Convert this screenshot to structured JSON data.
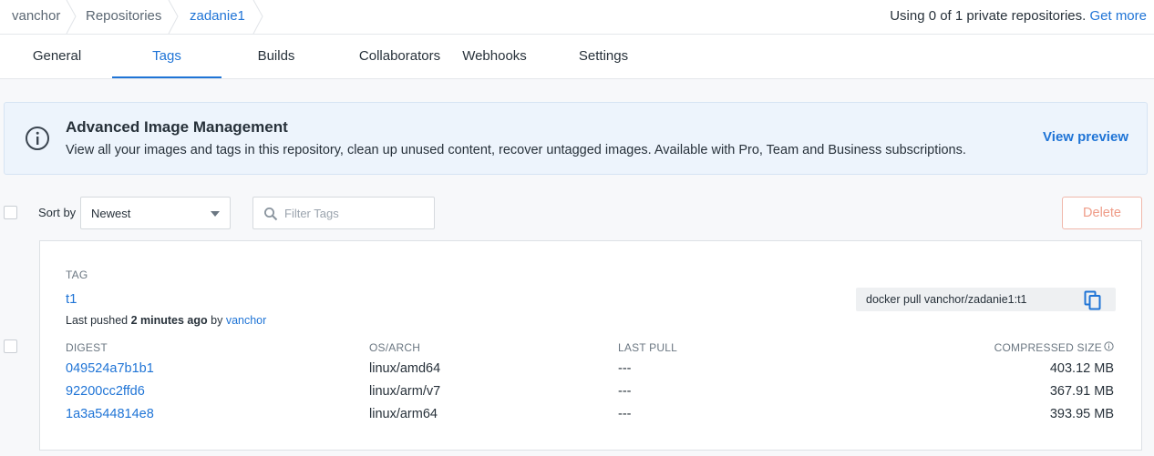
{
  "breadcrumb": {
    "items": [
      "vanchor",
      "Repositories",
      "zadanie1"
    ]
  },
  "usage": {
    "text": "Using 0 of 1 private repositories.",
    "link": "Get more"
  },
  "tabs": [
    "General",
    "Tags",
    "Builds",
    "Collaborators",
    "Webhooks",
    "Settings"
  ],
  "active_tab": "Tags",
  "banner": {
    "icon": "info-icon",
    "title": "Advanced Image Management",
    "text": "View all your images and tags in this repository, clean up unused content, recover untagged images. Available with Pro, Team and Business subscriptions.",
    "link": "View preview"
  },
  "filters": {
    "sort_label": "Sort by",
    "sort_value": "Newest",
    "filter_placeholder": "Filter Tags",
    "delete_label": "Delete"
  },
  "tag": {
    "header": "TAG",
    "name": "t1",
    "pushed_prefix": "Last pushed",
    "pushed_time": "2 minutes ago",
    "pushed_by_word": "by",
    "pushed_by": "vanchor",
    "pull_command": "docker pull vanchor/zadanie1:t1",
    "columns": [
      "DIGEST",
      "OS/ARCH",
      "LAST PULL",
      "COMPRESSED SIZE"
    ],
    "rows": [
      {
        "digest": "049524a7b1b1",
        "os_arch": "linux/amd64",
        "last_pull": "---",
        "size": "403.12 MB"
      },
      {
        "digest": "92200cc2ffd6",
        "os_arch": "linux/arm/v7",
        "last_pull": "---",
        "size": "367.91 MB"
      },
      {
        "digest": "1a3a544814e8",
        "os_arch": "linux/arm64",
        "last_pull": "---",
        "size": "393.95 MB"
      }
    ]
  },
  "colors": {
    "accent": "#1f74d6",
    "danger": "#ef9c88",
    "banner_bg": "#edf4fc"
  }
}
